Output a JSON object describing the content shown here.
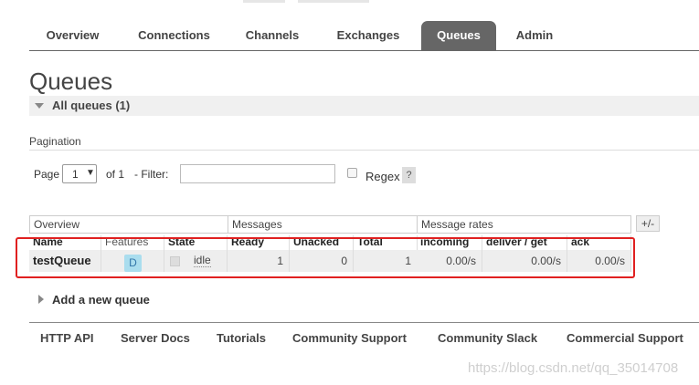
{
  "nav": {
    "tabs": [
      "Overview",
      "Connections",
      "Channels",
      "Exchanges",
      "Queues",
      "Admin"
    ],
    "active": "Queues"
  },
  "page": {
    "title": "Queues",
    "section_label": "All queues (1)"
  },
  "pagination": {
    "title": "Pagination",
    "page_label": "Page",
    "page_value": "1",
    "of_label": "of 1",
    "filter_label": "- Filter:",
    "filter_value": "",
    "regex_label": "Regex",
    "help_label": "?"
  },
  "table": {
    "groups": [
      "Overview",
      "Messages",
      "Message rates"
    ],
    "toggle_label": "+/-",
    "headers": [
      "Name",
      "Features",
      "State",
      "Ready",
      "Unacked",
      "Total",
      "incoming",
      "deliver / get",
      "ack"
    ],
    "rows": [
      {
        "name": "testQueue",
        "feature": "D",
        "state": "idle",
        "ready": "1",
        "unacked": "0",
        "total": "1",
        "incoming": "0.00/s",
        "deliver_get": "0.00/s",
        "ack": "0.00/s"
      }
    ]
  },
  "add_queue": {
    "label": "Add a new queue"
  },
  "footer": {
    "links": [
      "HTTP API",
      "Server Docs",
      "Tutorials",
      "Community Support",
      "Community Slack",
      "Commercial Support"
    ]
  },
  "watermark": "https://blog.csdn.net/qq_35014708",
  "colors": {
    "active_tab": "#666666",
    "highlight_border": "#e02020",
    "feature_badge": "#aaddee"
  }
}
